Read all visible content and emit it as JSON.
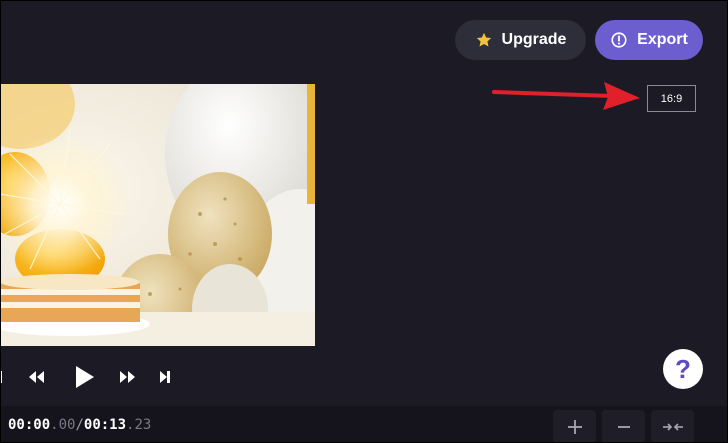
{
  "header": {
    "upgrade": {
      "label": "Upgrade",
      "icon": "star-icon",
      "icon_color": "#f5c33b"
    },
    "export": {
      "label": "Export",
      "icon": "export-icon",
      "bg_color": "#6c5ecf"
    }
  },
  "canvas": {
    "aspect_ratio": "16:9"
  },
  "annotation": {
    "arrow_color": "#e0202a"
  },
  "preview": {
    "description_icon": "video-thumbnail"
  },
  "controls": {
    "items": [
      "skip-start-icon",
      "rewind-icon",
      "play-icon",
      "fast-forward-icon",
      "skip-end-icon"
    ]
  },
  "timeline": {
    "current_main": "00:00",
    "current_frac": ".00",
    "separator": "/",
    "total_main": "00:13",
    "total_frac": ".23",
    "zoom_in_icon": "plus-icon",
    "zoom_out_icon": "minus-icon",
    "fit_icon": "fit-to-screen-icon"
  },
  "help": {
    "label": "?"
  }
}
